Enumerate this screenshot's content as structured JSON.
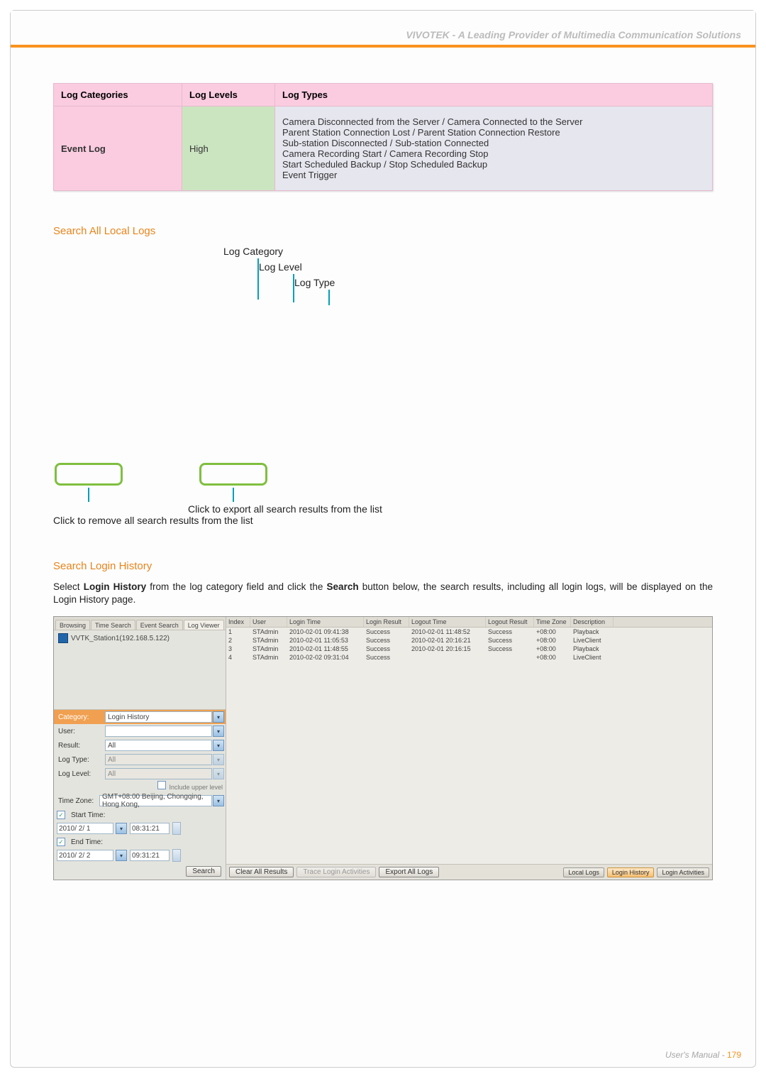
{
  "header": {
    "title": "VIVOTEK - A Leading Provider of Multimedia Communication Solutions"
  },
  "table": {
    "headers": [
      "Log Categories",
      "Log Levels",
      "Log Types"
    ],
    "row": {
      "category": "Event Log",
      "level": "High",
      "types": "Camera Disconnected from the Server / Camera Connected to the Server\nParent Station Connection Lost / Parent Station Connection Restore\nSub-station Disconnected / Sub-station Connected\nCamera Recording Start / Camera Recording Stop\nStart Scheduled Backup / Stop Scheduled Backup\nEvent Trigger"
    }
  },
  "section1": {
    "title": "Search All Local Logs",
    "labels": {
      "l1": "Log Category",
      "l2": "Log Level",
      "l3": "Log Type"
    },
    "caption_export": "Click to export all search results from the list",
    "caption_clear": "Click to remove all search results from the list"
  },
  "section2": {
    "title": "Search Login History",
    "body": "Select Login History from the log category field and click the Search button below, the search results, including all login logs, will be displayed on the Login History page."
  },
  "shot": {
    "tabs": [
      "Browsing",
      "Time Search",
      "Event Search",
      "Log Viewer"
    ],
    "station": "VVTK_Station1(192.168.5.122)",
    "form": {
      "category_label": "Category:",
      "category_value": "Login History",
      "user_label": "User:",
      "user_value": "",
      "result_label": "Result:",
      "result_value": "All",
      "logtype_label": "Log Type:",
      "logtype_value": "All",
      "loglevel_label": "Log Level:",
      "loglevel_value": "All",
      "include_label": "Include upper level",
      "tz_label": "Time Zone:",
      "tz_value": "GMT+08:00 Beijing, Chongqing, Hong Kong,",
      "start_label": "Start Time:",
      "start_date": "2010/ 2/ 1",
      "start_time": "08:31:21",
      "end_label": "End Time:",
      "end_date": "2010/ 2/ 2",
      "end_time": "09:31:21",
      "search_btn": "Search"
    },
    "cols": [
      "Index",
      "User",
      "Login Time",
      "Login Result",
      "Logout Time",
      "Logout Result",
      "Time Zone",
      "Description"
    ],
    "rows": [
      {
        "idx": "1",
        "user": "STAdmin",
        "login": "2010-02-01 09:41:38",
        "lres": "Success",
        "logout": "2010-02-01 11:48:52",
        "ores": "Success",
        "tz": "+08:00",
        "desc": "Playback"
      },
      {
        "idx": "2",
        "user": "STAdmin",
        "login": "2010-02-01 11:05:53",
        "lres": "Success",
        "logout": "2010-02-01 20:16:21",
        "ores": "Success",
        "tz": "+08:00",
        "desc": "LiveClient"
      },
      {
        "idx": "3",
        "user": "STAdmin",
        "login": "2010-02-01 11:48:55",
        "lres": "Success",
        "logout": "2010-02-01 20:16:15",
        "ores": "Success",
        "tz": "+08:00",
        "desc": "Playback"
      },
      {
        "idx": "4",
        "user": "STAdmin",
        "login": "2010-02-02 09:31:04",
        "lres": "Success",
        "logout": "",
        "ores": "",
        "tz": "+08:00",
        "desc": "LiveClient"
      }
    ],
    "bottom": {
      "clear": "Clear All Results",
      "trace": "Trace Login Activities",
      "export": "Export All Logs",
      "local": "Local Logs",
      "history": "Login History",
      "activities": "Login Activities"
    }
  },
  "footer": {
    "text": "User's Manual - ",
    "page": "179"
  }
}
